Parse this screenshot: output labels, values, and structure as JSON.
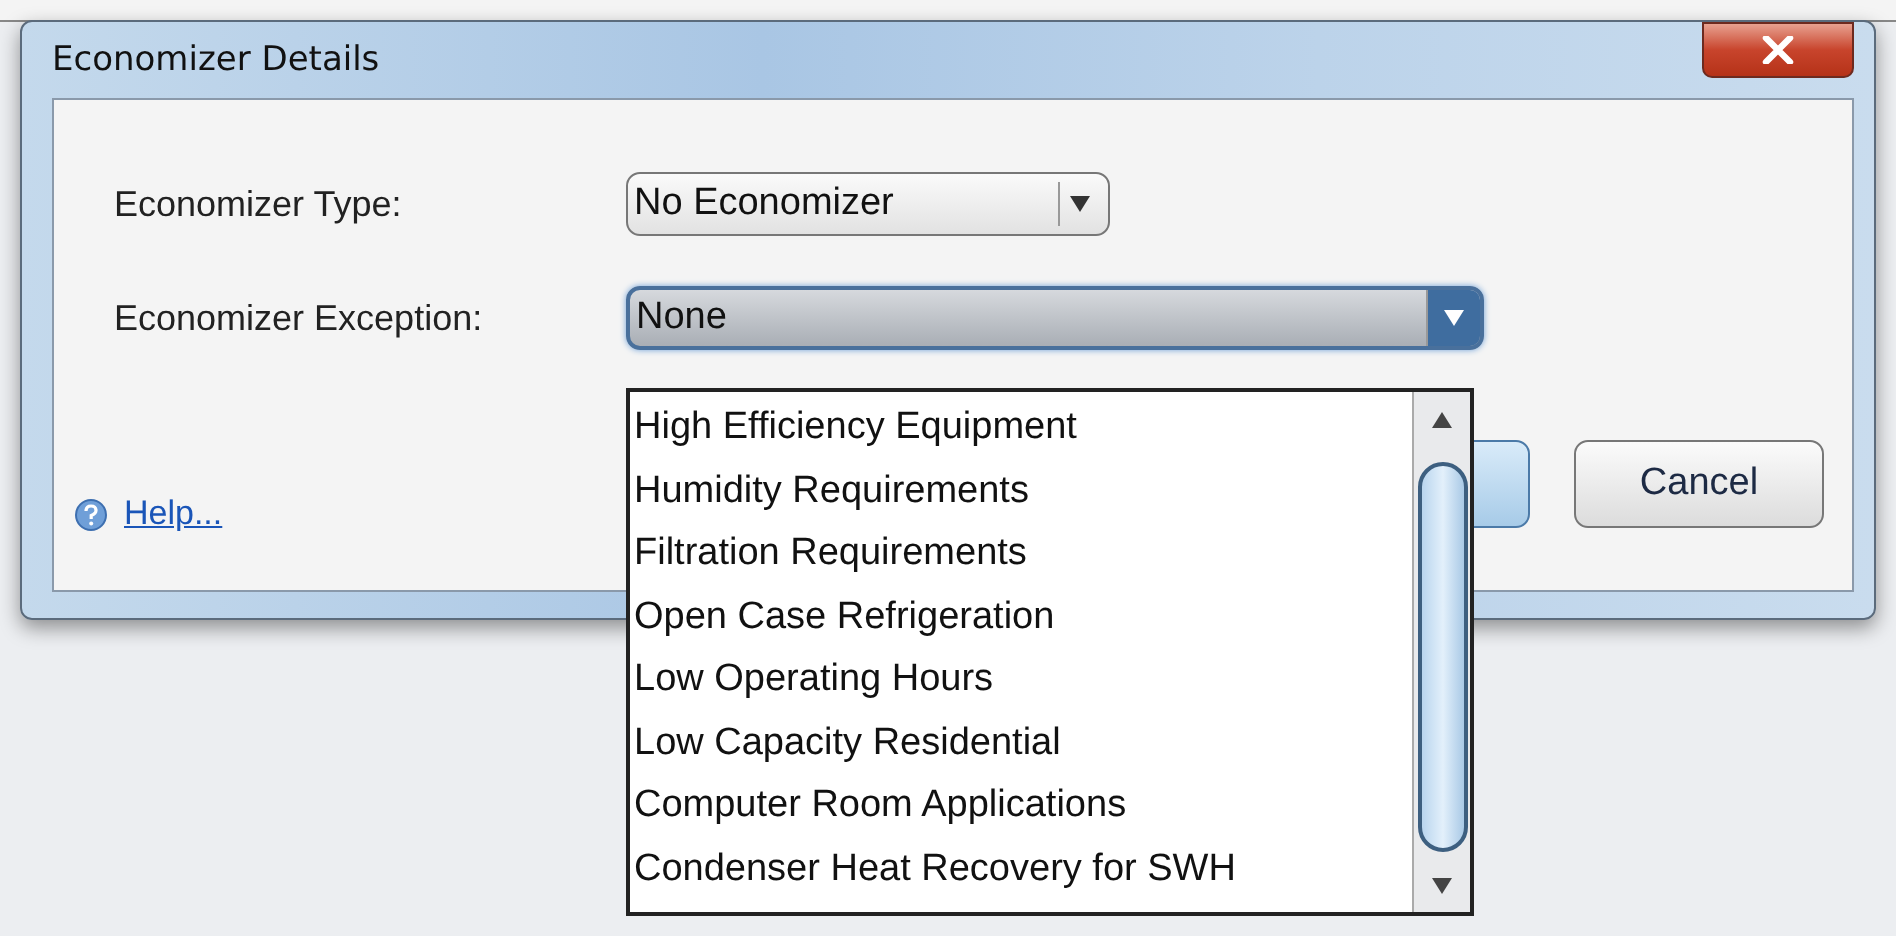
{
  "window": {
    "title": "Economizer Details"
  },
  "fields": [
    {
      "label": "Economizer Type:",
      "value": "No Economizer",
      "focused": false
    },
    {
      "label": "Economizer Exception:",
      "value": "None",
      "focused": true
    }
  ],
  "dropdown": {
    "options": [
      {
        "label": "High Efficiency Equipment",
        "selected": false
      },
      {
        "label": "Humidity Requirements",
        "selected": false
      },
      {
        "label": "Filtration Requirements",
        "selected": false
      },
      {
        "label": "Open Case Refrigeration",
        "selected": false
      },
      {
        "label": "Low Operating Hours",
        "selected": false
      },
      {
        "label": "Low Capacity Residential",
        "selected": false
      },
      {
        "label": "Computer Room Applications",
        "selected": false
      },
      {
        "label": "Condenser Heat Recovery for SWH",
        "selected": false
      }
    ]
  },
  "help_link": "Help...",
  "buttons": [
    "Cancel"
  ]
}
